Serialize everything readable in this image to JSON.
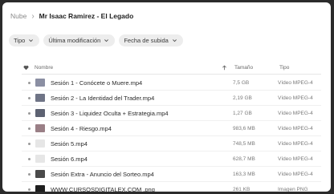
{
  "breadcrumb": {
    "root": "Nube",
    "current": "Mr Isaac Ramirez - El Legado"
  },
  "filters": [
    {
      "label": "Tipo"
    },
    {
      "label": "Última modificación"
    },
    {
      "label": "Fecha de subida"
    }
  ],
  "columns": {
    "name": "Nombre",
    "size": "Tamaño",
    "type": "Tipo"
  },
  "files": [
    {
      "name": "Sesión 1 - Conócete o Muere.mp4",
      "size": "7,5 GB",
      "type": "Vídeo MPEG-4",
      "thumb_color": "#8b8fa3"
    },
    {
      "name": "Sesión 2 - La Identidad del Trader.mp4",
      "size": "2,19 GB",
      "type": "Vídeo MPEG-4",
      "thumb_color": "#6f7486"
    },
    {
      "name": "Sesión 3 - Liquidez Oculta + Estrategia.mp4",
      "size": "1,27 GB",
      "type": "Vídeo MPEG-4",
      "thumb_color": "#5d6272"
    },
    {
      "name": "Sesión 4 - Riesgo.mp4",
      "size": "983,6 MB",
      "type": "Vídeo MPEG-4",
      "thumb_color": "#9a7f86"
    },
    {
      "name": "Sesión 5.mp4",
      "size": "748,5 MB",
      "type": "Vídeo MPEG-4",
      "thumb_color": "#e6e6e6"
    },
    {
      "name": "Sesión 6.mp4",
      "size": "628,7 MB",
      "type": "Vídeo MPEG-4",
      "thumb_color": "#e6e6e6"
    },
    {
      "name": "Sesión Extra - Anuncio del Sorteo.mp4",
      "size": "163,3 MB",
      "type": "Vídeo MPEG-4",
      "thumb_color": "#4a4a4a"
    },
    {
      "name": "WWW.CURSOSDIGITALEX.COM .png",
      "size": "261 KB",
      "type": "Imagen PNG",
      "thumb_color": "#1e1e1e"
    }
  ]
}
